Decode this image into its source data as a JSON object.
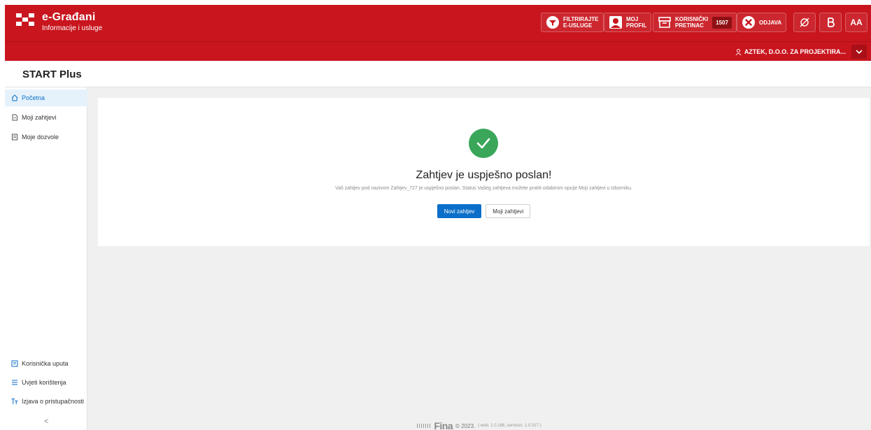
{
  "header": {
    "brand_title": "e-Građani",
    "brand_subtitle": "Informacije i usluge",
    "filter": {
      "line1": "FILTRIRAJTE",
      "line2": "E-USLUGE"
    },
    "profile": {
      "line1": "MOJ",
      "line2": "PROFIL"
    },
    "inbox": {
      "line1": "KORISNIČKI",
      "line2": "PRETINAC",
      "count": "1507"
    },
    "logout_label": "ODJAVA",
    "font_size_label": "AA",
    "user_name": "AZTEK, D.O.O. ZA PROJEKTIRA..."
  },
  "app_title": "START Plus",
  "sidebar": {
    "items": [
      {
        "label": "Početna",
        "icon": "home-icon"
      },
      {
        "label": "Moji zahtjevi",
        "icon": "document-icon"
      },
      {
        "label": "Moje dozvole",
        "icon": "permit-icon"
      }
    ],
    "bottom_items": [
      {
        "label": "Korisnička uputa",
        "icon": "manual-icon"
      },
      {
        "label": "Uvjeti korištenja",
        "icon": "list-icon"
      },
      {
        "label": "Izjava o pristupačnosti",
        "icon": "text-size-icon"
      }
    ],
    "collapse_label": "<"
  },
  "main": {
    "success_title": "Zahtjev je uspješno poslan!",
    "success_desc": "Vaš zahtjev pod nazivom Zahtjev_727 je uspješno poslan. Status Vašeg zahtjeva možete pratiti odabirom opcije Moji zahtjevi u Izborniku.",
    "primary_button": "Novi zahtjev",
    "secondary_button": "Moji zahtjevi"
  },
  "footer": {
    "logo_text": "Fina",
    "copyright": "© 2023.",
    "version": "( web: 1.0.186, services: 1.0.317 )"
  },
  "colors": {
    "brand_red": "#c8151e",
    "accent_blue": "#0b6fc9",
    "success_green": "#3aa65a"
  }
}
